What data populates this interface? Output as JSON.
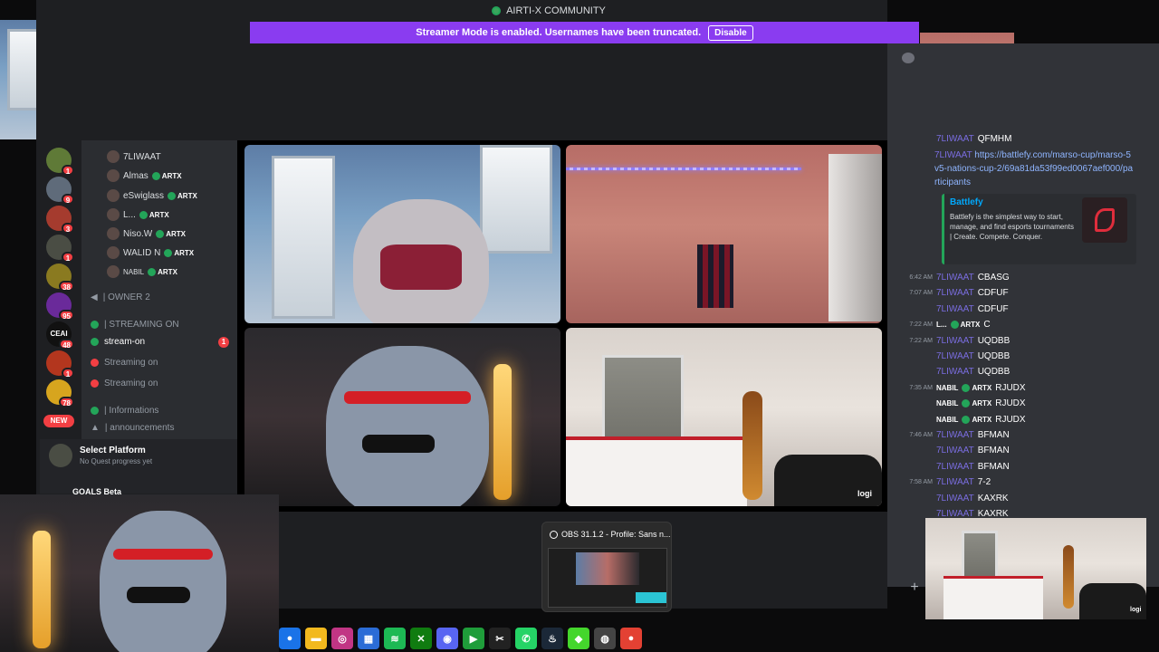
{
  "window": {
    "title": "AIRTI-X COMMUNITY"
  },
  "streamer_mode": {
    "message": "Streamer Mode is enabled. Usernames have been truncated.",
    "disable_label": "Disable"
  },
  "servers": [
    {
      "badge": "1"
    },
    {
      "badge": "9"
    },
    {
      "badge": "3"
    },
    {
      "badge": "1"
    },
    {
      "badge": "38"
    },
    {
      "badge": "95"
    },
    {
      "label": "CEAI",
      "badge": "48"
    },
    {
      "badge": "1"
    },
    {
      "badge": "78"
    }
  ],
  "new_label": "NEW",
  "voice_members": [
    {
      "name": "7LIWAAT",
      "tag": ""
    },
    {
      "name": "Almas",
      "tag": "ARTX"
    },
    {
      "name": "eSwiglass",
      "tag": "ARTX"
    },
    {
      "name": "L...",
      "tag": "ARTX"
    },
    {
      "name": "Niso.W",
      "tag": "ARTX"
    },
    {
      "name": "WALID N",
      "tag": "ARTX"
    },
    {
      "name": "NABIL",
      "tag": "ARTX"
    }
  ],
  "channels": {
    "owner": "| OWNER 2",
    "streaming_category": "| STREAMING ON",
    "stream_on": "stream-on",
    "stream_on_badge": "1",
    "streaming1": "Streaming on",
    "streaming2": "Streaming on",
    "info_category": "| Informations",
    "announcements": "| announcements"
  },
  "quest": {
    "title": "Select Platform",
    "subtitle": "No Quest progress yet"
  },
  "goals": {
    "label": "GOALS Beta"
  },
  "chat": {
    "messages": [
      {
        "time": "",
        "user": "7LIWAAT",
        "text": "QFMHM"
      },
      {
        "time": "",
        "user": "7LIWAAT",
        "text": "https://battlefy.com/marso-cup/marso-5v5-nations-cup-2/69a81da53f99ed0067aef000/participants"
      }
    ],
    "embed": {
      "title": "Battlefy",
      "desc": "Battlefy is the simplest way to start, manage, and find esports tournaments | Create. Compete. Conquer."
    },
    "later": [
      {
        "time": "6:42 AM",
        "user": "7LIWAAT",
        "text": "CBASG"
      },
      {
        "time": "7:07 AM",
        "user": "7LIWAAT",
        "text": "CDFUF"
      },
      {
        "time": "",
        "user": "7LIWAAT",
        "text": "CDFUF"
      },
      {
        "time": "7:22 AM",
        "user": "L...",
        "tag": "ARTX",
        "text": "C"
      },
      {
        "time": "7:22 AM",
        "user": "7LIWAAT",
        "text": "UQDBB"
      },
      {
        "time": "",
        "user": "7LIWAAT",
        "text": "UQDBB"
      },
      {
        "time": "",
        "user": "7LIWAAT",
        "text": "UQDBB"
      },
      {
        "time": "7:35 AM",
        "user": "NABIL",
        "tag": "ARTX",
        "text": "RJUDX"
      },
      {
        "time": "",
        "user": "NABIL",
        "tag": "ARTX",
        "text": "RJUDX"
      },
      {
        "time": "",
        "user": "NABIL",
        "tag": "ARTX",
        "text": "RJUDX"
      },
      {
        "time": "7:46 AM",
        "user": "7LIWAAT",
        "text": "BFMAN"
      },
      {
        "time": "",
        "user": "7LIWAAT",
        "text": "BFMAN"
      },
      {
        "time": "",
        "user": "7LIWAAT",
        "text": "BFMAN"
      },
      {
        "time": "7:58 AM",
        "user": "7LIWAAT",
        "text": "7-2"
      },
      {
        "time": "",
        "user": "7LIWAAT",
        "text": "KAXRK"
      },
      {
        "time": "",
        "user": "7LIWAAT",
        "text": "KAXRK"
      }
    ]
  },
  "video_watermark": "logi",
  "obs": {
    "title": "OBS 31.1.2 - Profile: Sans n..."
  },
  "taskbar": [
    "chrome-icon",
    "folder-icon",
    "instagram-icon",
    "store-icon",
    "spotify-icon",
    "xbox-icon",
    "discord-icon",
    "terminal-icon",
    "capcut-icon",
    "whatsapp-icon",
    "steam-icon",
    "razer-icon",
    "obs-icon",
    "chrome-alt-icon"
  ]
}
